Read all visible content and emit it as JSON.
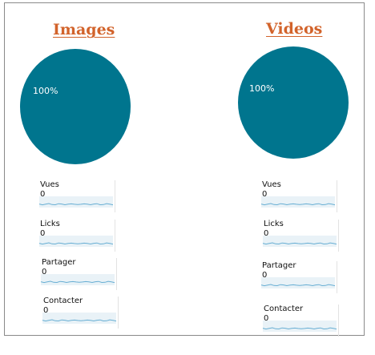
{
  "colors": {
    "title": "#d2632b",
    "pie": "#00758e",
    "pie_label": "#ffffff",
    "sparkline": "#67aed3",
    "sparkline_fill": "#e9f2f7"
  },
  "chart_data": [
    {
      "type": "pie",
      "title": "Images",
      "values": [
        100
      ],
      "slice_labels": [
        "100%"
      ],
      "color": "#00758e"
    },
    {
      "type": "pie",
      "title": "Videos",
      "values": [
        100
      ],
      "slice_labels": [
        "100%"
      ],
      "color": "#00758e"
    }
  ],
  "panels": {
    "images": {
      "title": "Images",
      "pie_label": "100%",
      "stats": [
        {
          "label": "Vues",
          "value": "0"
        },
        {
          "label": "Licks",
          "value": "0"
        },
        {
          "label": "Partager",
          "value": "0"
        },
        {
          "label": "Contacter",
          "value": "0"
        }
      ]
    },
    "videos": {
      "title": "Videos",
      "pie_label": "100%",
      "stats": [
        {
          "label": "Vues",
          "value": "0"
        },
        {
          "label": "Licks",
          "value": "0"
        },
        {
          "label": "Partager",
          "value": "0"
        },
        {
          "label": "Contacter",
          "value": "0"
        }
      ]
    }
  }
}
